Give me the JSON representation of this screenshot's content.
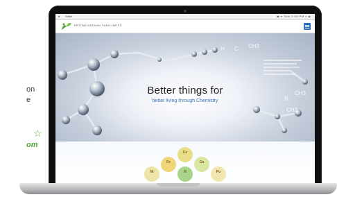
{
  "left_copy": {
    "line1": "on",
    "line2": "e",
    "line3": "om"
  },
  "os_bar": {
    "app": "Safari",
    "status": "◀ ᯤ Sun 2:00 PM  ⌕ ☰"
  },
  "site": {
    "company_name": "EPITOME BASAVAN TIARA LIMITED",
    "menu_icon": "hamburger-menu-icon",
    "logo_icon": "leaf-logo-icon"
  },
  "hero": {
    "title": "Better things for",
    "subtitle": "better living through Chemistry",
    "formulas": [
      "H",
      "C",
      "CH3",
      "N",
      "CH3",
      "CH3"
    ]
  },
  "elements": [
    {
      "symbol": "Cu",
      "name": ""
    },
    {
      "symbol": "Fe",
      "name": ""
    },
    {
      "symbol": "Co",
      "name": ""
    },
    {
      "symbol": "Ni",
      "name": ""
    },
    {
      "symbol": "N",
      "name": ""
    },
    {
      "symbol": "Pu",
      "name": ""
    }
  ],
  "colors": {
    "brand_green": "#53a53a",
    "link_blue": "#3a72b8",
    "menu_blue": "#2a73c9"
  }
}
